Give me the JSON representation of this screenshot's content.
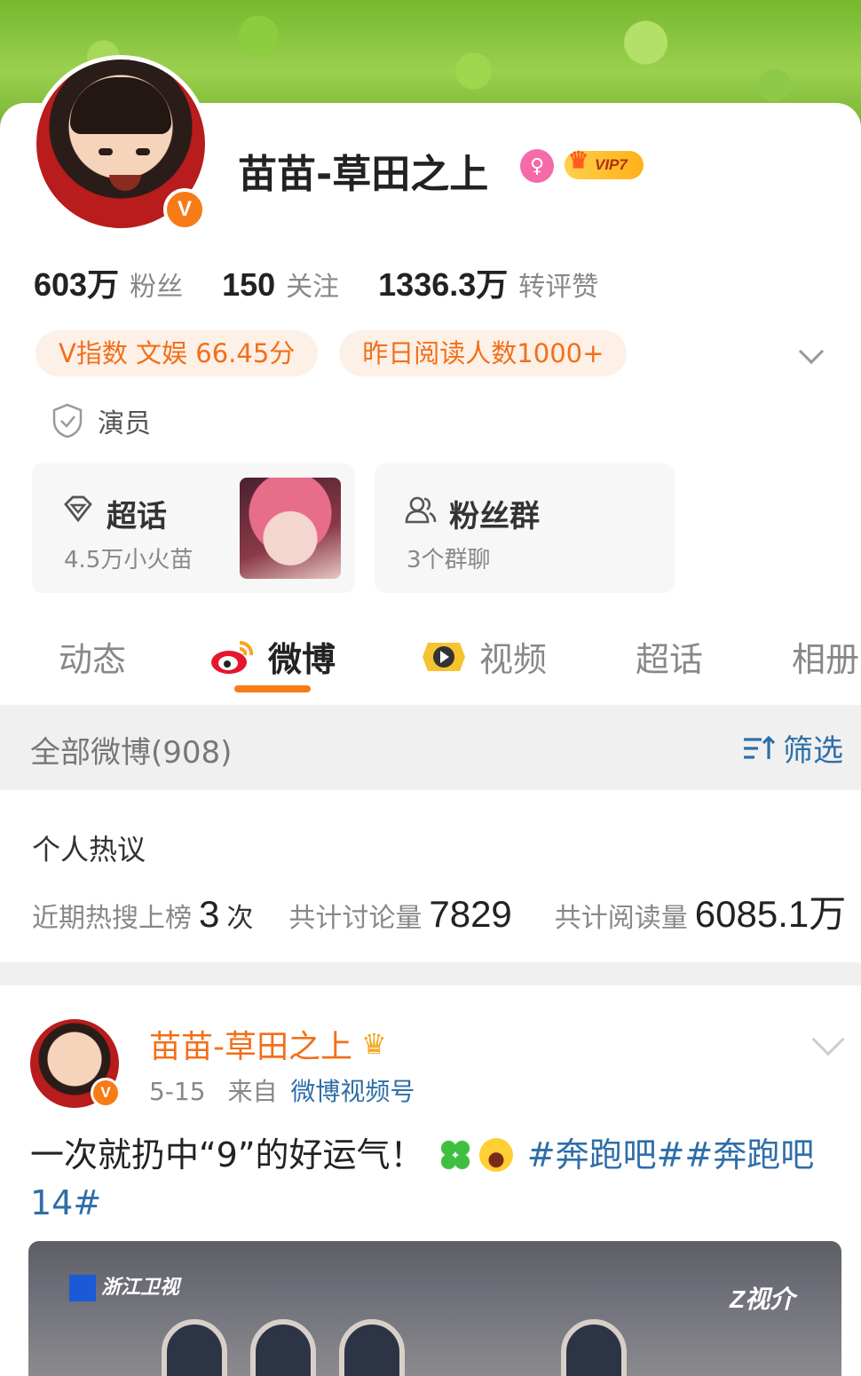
{
  "profile": {
    "name": "苗苗-草田之上",
    "verified_badge": "V",
    "vip_label": "VIP7",
    "gender_icon": "female-icon",
    "stats": [
      {
        "value": "603万",
        "label": "粉丝"
      },
      {
        "value": "150",
        "label": "关注"
      },
      {
        "value": "1336.3万",
        "label": "转评赞"
      }
    ],
    "pills": [
      "V指数 文娱 66.45分",
      "昨日阅读人数1000+"
    ],
    "role": "演员"
  },
  "cards": {
    "supertopic": {
      "title": "超话",
      "sub": "4.5万小火苗"
    },
    "fans_group": {
      "title": "粉丝群",
      "sub": "3个群聊"
    }
  },
  "tabs": [
    {
      "label": "动态"
    },
    {
      "label": "微博"
    },
    {
      "label": "视频"
    },
    {
      "label": "超话"
    },
    {
      "label": "相册"
    }
  ],
  "filter_bar": {
    "count_label": "全部微博(908)",
    "filter_label": "筛选"
  },
  "hot": {
    "title": "个人热议",
    "search_label": "近期热搜上榜",
    "search_value": "3",
    "search_unit": "次",
    "discuss_label": "共计讨论量",
    "discuss_value": "7829",
    "read_label": "共计阅读量",
    "read_value": "6085.1万"
  },
  "post": {
    "author": "苗苗-草田之上",
    "date": "5-15",
    "from_label": "来自",
    "source": "微博视频号",
    "text": "一次就扔中“9”的好运气！",
    "tags": "#奔跑吧##奔跑吧14#",
    "video_logo_left": "浙江卫视",
    "video_logo_right": "Z视介"
  },
  "colors": {
    "accent": "#f77b17",
    "link": "#2f6ea8",
    "pill_bg": "#fdf0e6"
  }
}
